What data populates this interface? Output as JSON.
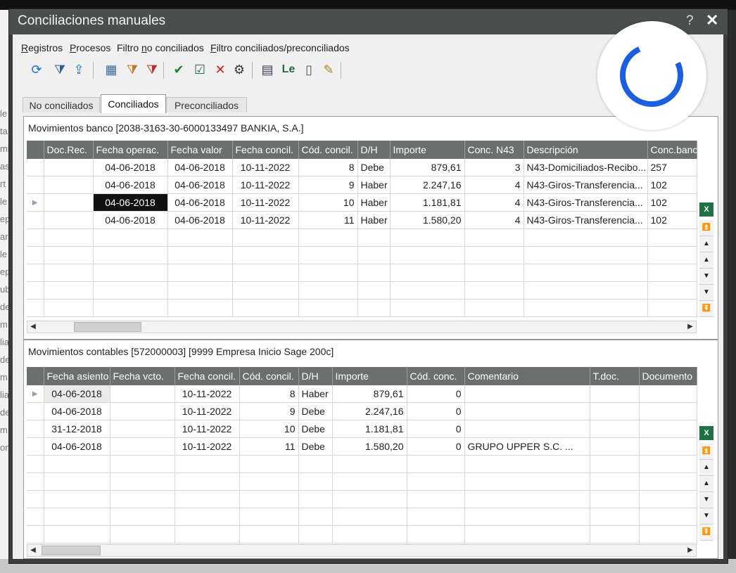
{
  "window": {
    "title": "Conciliaciones manuales",
    "help_glyph": "?",
    "close_glyph": "✕"
  },
  "menu": [
    {
      "pre": "",
      "acc": "R",
      "post": "egistros"
    },
    {
      "pre": "",
      "acc": "P",
      "post": "rocesos"
    },
    {
      "pre": "Filtro ",
      "acc": "n",
      "post": "o conciliados"
    },
    {
      "pre": "",
      "acc": "F",
      "post": "iltro conciliados/preconciliados"
    }
  ],
  "toolbar_icons": [
    "refresh-icon",
    "filter-icon",
    "filter-up-icon",
    "grid-filter-icon",
    "filter-add-icon",
    "filter-remove-icon",
    "check-icon",
    "doc-check-icon",
    "cancel-icon",
    "gear-icon",
    "layers-icon",
    "le-icon",
    "blank-doc-icon",
    "edit-pencil-icon"
  ],
  "tabs": [
    "No conciliados",
    "Conciliados",
    "Preconciliados"
  ],
  "active_tab": 1,
  "bank": {
    "title": "Movimientos banco  [2038-3163-30-6000133497  BANKIA, S.A.]",
    "headers": [
      "Doc.Rec.",
      "Fecha operac.",
      "Fecha valor",
      "Fecha concil.",
      "Cód. concil.",
      "D/H",
      "Importe",
      "Conc. N43",
      "Descripción",
      "Conc.banc"
    ],
    "rows": [
      [
        "",
        "04-06-2018",
        "04-06-2018",
        "10-11-2022",
        "8",
        "Debe",
        "879,61",
        "3",
        "N43-Domiciliados-Recibo...",
        "257"
      ],
      [
        "",
        "04-06-2018",
        "04-06-2018",
        "10-11-2022",
        "9",
        "Haber",
        "2.247,16",
        "4",
        "N43-Giros-Transferencia...",
        "102"
      ],
      [
        "",
        "04-06-2018",
        "04-06-2018",
        "10-11-2022",
        "10",
        "Haber",
        "1.181,81",
        "4",
        "N43-Giros-Transferencia...",
        "102"
      ],
      [
        "",
        "04-06-2018",
        "04-06-2018",
        "10-11-2022",
        "11",
        "Haber",
        "1.580,20",
        "4",
        "N43-Giros-Transferencia...",
        "102"
      ]
    ]
  },
  "accounting": {
    "title": "Movimientos contables  [572000003] [9999 Empresa Inicio Sage 200c]",
    "headers": [
      "Fecha asiento",
      "Fecha vcto.",
      "Fecha concil.",
      "Cód. concil.",
      "D/H",
      "Importe",
      "Cód. conc.",
      "Comentario",
      "T.doc.",
      "Documento"
    ],
    "rows": [
      [
        "04-06-2018",
        "",
        "10-11-2022",
        "8",
        "Haber",
        "879,61",
        "0",
        "",
        "",
        ""
      ],
      [
        "04-06-2018",
        "",
        "10-11-2022",
        "9",
        "Debe",
        "2.247,16",
        "0",
        "",
        "",
        ""
      ],
      [
        "31-12-2018",
        "",
        "10-11-2022",
        "10",
        "Debe",
        "1.181,81",
        "0",
        "",
        "",
        ""
      ],
      [
        "04-06-2018",
        "",
        "10-11-2022",
        "11",
        "Debe",
        "1.580,20",
        "0",
        "GRUPO UPPER S.C.      ...",
        "",
        ""
      ]
    ]
  },
  "nav_glyphs": [
    "⏫",
    "▲",
    "▲",
    "▼",
    "▼",
    "⏬"
  ],
  "excel_label": "X",
  "left_fragments": [
    "le",
    "ta",
    "mi",
    "as",
    "rt",
    "le",
    "ep",
    "ar",
    "le",
    "ep",
    "ub",
    "de",
    "m",
    "lia",
    "de",
    "m",
    "lia",
    "de",
    "m",
    "on"
  ]
}
